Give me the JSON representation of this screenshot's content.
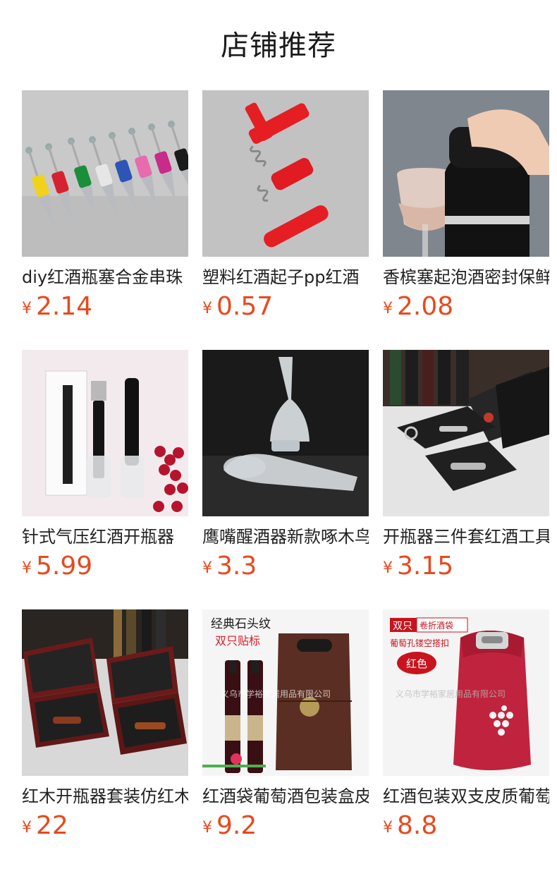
{
  "header": {
    "title": "店铺推荐"
  },
  "products": [
    {
      "title": "diy红酒瓶塞合金串珠",
      "currency": "¥",
      "price": "2.14",
      "image": "bottle-stoppers-image"
    },
    {
      "title": "塑料红酒起子pp红酒",
      "currency": "¥",
      "price": "0.57",
      "image": "corkscrew-image"
    },
    {
      "title": "香槟塞起泡酒密封保鲜",
      "currency": "¥",
      "price": "2.08",
      "image": "champagne-stopper-image"
    },
    {
      "title": "针式气压红酒开瓶器",
      "currency": "¥",
      "price": "5.99",
      "image": "air-pressure-opener-image"
    },
    {
      "title": "鹰嘴醒酒器新款啄木鸟",
      "currency": "¥",
      "price": "3.3",
      "image": "aerator-pourer-image"
    },
    {
      "title": "开瓶器三件套红酒工具",
      "currency": "¥",
      "price": "3.15",
      "image": "opener-gift-set-image"
    },
    {
      "title": "红木开瓶器套装仿红木",
      "currency": "¥",
      "price": "22",
      "image": "wooden-box-set-image"
    },
    {
      "title": "红酒袋葡萄酒包装盒皮",
      "currency": "¥",
      "price": "9.2",
      "image": "wine-bag-double-image",
      "overlay": {
        "line1": "经典石头纹",
        "line2": "双只贴标",
        "watermark": "义乌市学裕家居用品有限公司"
      }
    },
    {
      "title": "红酒包装双支皮质葡萄",
      "currency": "¥",
      "price": "8.8",
      "image": "red-leather-bag-image",
      "overlay": {
        "tag1": "双只",
        "tag2": "卷折酒袋",
        "line2": "葡萄孔镂空搭扣",
        "badge": "红色",
        "watermark": "义乌市学裕家居用品有限公司"
      }
    }
  ]
}
